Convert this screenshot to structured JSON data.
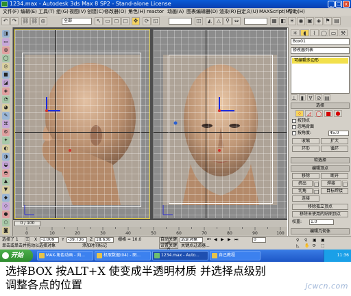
{
  "window": {
    "title": "1234.max - Autodesk 3ds Max 8 SP2 - Stand-alone License",
    "minimize_glyph": "_",
    "maximize_glyph": "□",
    "close_glyph": "x"
  },
  "menu": [
    "文件(F)",
    "编辑(E)",
    "工具(T)",
    "组(G)",
    "视图(V)",
    "创建(C)",
    "修改器(O)",
    "角色(H)",
    "reactor",
    "动画(A)",
    "图表编辑器(D)",
    "渲染(R)",
    "自定义(U)",
    "MAXScript(M)",
    "帮助(H)"
  ],
  "toolbar": {
    "selection_filter": "全部",
    "named_selection_placeholder": "",
    "left_buttons": [
      "↶",
      "↷",
      "⛓",
      "⛓",
      "◎",
      "↖",
      "▭",
      "◻",
      "▢",
      "✥"
    ],
    "right_buttons": [
      "◭",
      "△",
      "⚲",
      "⇔",
      "▦",
      "◧",
      "☀",
      "◉",
      "▣",
      "◈",
      "⚑",
      "▤"
    ]
  },
  "left_tools": [
    "◨",
    "▭",
    "◍",
    "◯",
    "◎",
    "■",
    "◪",
    "◈",
    "◔",
    "◕",
    "✎",
    "⌘",
    "⚙",
    "✦",
    "◐",
    "◑",
    "◒",
    "◓",
    "▲",
    "▼",
    "◆",
    "◇",
    "●",
    "○",
    "◙"
  ],
  "right_panel": {
    "object_name": "Box01",
    "modifier_list": "修改器列表",
    "stack_item": "可编辑多边形",
    "selection_header": "选择",
    "by_vertex": "按顶点",
    "ignore_backfacing": "忽略背面",
    "by_angle": "按角度:",
    "angle_value": "45.0",
    "shrink": "收缩",
    "grow": "扩大",
    "ring": "环形",
    "loop": "循环",
    "soft_selection_header": "软选择",
    "edit_vertices_header": "编辑顶点",
    "remove": "移除",
    "break": "断开",
    "extrude": "挤出",
    "weld": "焊接",
    "chamfer": "切角",
    "target_weld": "目标焊接",
    "connect": "连接",
    "remove_isolated": "移除孤立顶点",
    "remove_unused_map": "移除未使用的贴图顶点",
    "weight_label": "权重:",
    "weight_value": "1.0",
    "edit_geometry_header": "编辑几何体"
  },
  "timeline": {
    "frame_readout": "0 / 100",
    "ruler_ticks": [
      "0",
      "10",
      "20",
      "30",
      "40",
      "50",
      "60",
      "70",
      "80",
      "90",
      "100"
    ]
  },
  "status": {
    "selected": "选择了 1",
    "x_value": "-1.009",
    "y_value": "-39.736",
    "z_value": "18.636",
    "grid": "栅格 = 10.0",
    "auto_key": "自动关键点",
    "set_key": "设置关键点",
    "key_filters": "关键点过滤器...",
    "selected_obj": "选定对象",
    "prompt": "单击或单击并拖动以选择对象",
    "add_time_tag": "添加时间标记",
    "frame_field": "0"
  },
  "taskbar": {
    "start": "开始",
    "tasks": [
      "MAX-角色动画 - 向...",
      "机取数据(04) - 图...",
      "1234.max - Auto...",
      "自己教程"
    ],
    "clock": "11:36"
  },
  "caption": {
    "line1": "选择BOX 按ALT+X 使变成半透明材质 并选择点级别",
    "line2": "调整各点的位置"
  },
  "watermark": "jcwcn.com"
}
